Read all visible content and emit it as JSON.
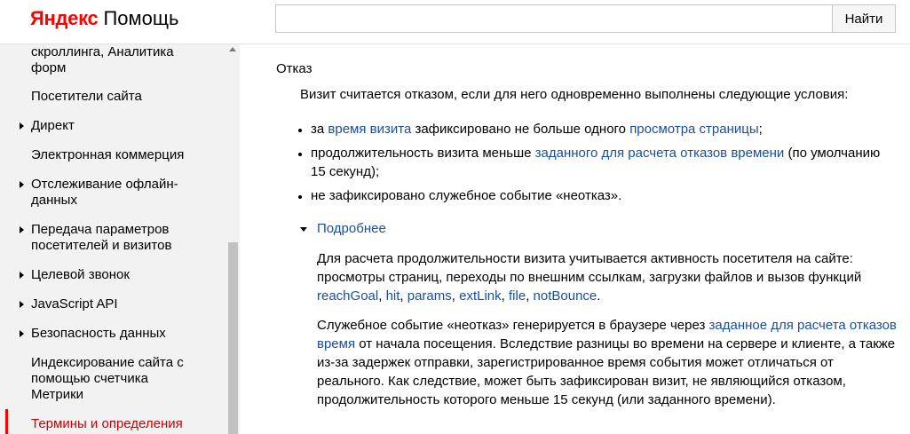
{
  "header": {
    "logo_brand": "Яндекс",
    "logo_service": "Помощь",
    "search": {
      "value": "",
      "placeholder": ""
    },
    "search_button": "Найти"
  },
  "sidebar": {
    "items": [
      {
        "label": "скроллинга, Аналитика форм",
        "has_arrow": false
      },
      {
        "label": "Посетители сайта",
        "has_arrow": false
      },
      {
        "label": "Директ",
        "has_arrow": true
      },
      {
        "label": "Электронная коммерция",
        "has_arrow": false
      },
      {
        "label": "Отслеживание офлайн-данных",
        "has_arrow": true
      },
      {
        "label": "Передача параметров посетителей и визитов",
        "has_arrow": true
      },
      {
        "label": "Целевой звонок",
        "has_arrow": true
      },
      {
        "label": "JavaScript API",
        "has_arrow": true
      },
      {
        "label": "Безопасность данных",
        "has_arrow": true
      },
      {
        "label": "Индексирование сайта с помощью счетчика Метрики",
        "has_arrow": false
      },
      {
        "label": "Термины и определения",
        "has_arrow": false,
        "active": true
      }
    ],
    "active_color": "#cc0000"
  },
  "main": {
    "title": "Отказ",
    "intro": "Визит считается отказом, если для него одновременно выполнены следующие условия:",
    "bullets": {
      "b1": {
        "pre": "за ",
        "link1": "время визита",
        "mid": " зафиксировано не больше одного ",
        "link2": "просмотра страницы",
        "post": ";"
      },
      "b2": {
        "pre": "продолжительность визита меньше ",
        "link": "заданного для расчета отказов времени",
        "post": " (по умолчанию 15 секунд);"
      },
      "b3": {
        "text": "не зафиксировано служебное событие «неотказ»."
      }
    },
    "details": {
      "label": "Подробнее",
      "p1": {
        "text": "Для расчета продолжительности визита учитывается активность посетителя на сайте: просмотры страниц, переходы по внешним ссылкам, загрузки файлов и вызов функций ",
        "reachGoal": "reachGoal",
        "hit": "hit",
        "params": "params",
        "extLink": "extLink",
        "file": "file",
        "notBounce": "notBounce",
        "sep": ", ",
        "end": "."
      },
      "p2": {
        "pre": "Служебное событие «неотказ» генерируется в браузере через ",
        "link": "заданное для расчета отказов время",
        "post": " от начала посещения. Вследствие разницы во времени на сервере и клиенте, а также из-за задержек отправки, зарегистрированное время события может отличаться от реального. Как следствие, может быть зафиксирован визит, не являющийся отказом, продолжительность которого меньше 15 секунд (или заданного времени)."
      }
    }
  },
  "colors": {
    "link": "#1a4fa0",
    "logo": "#ff0000",
    "sidebar_bg": "#f2f2f2"
  }
}
